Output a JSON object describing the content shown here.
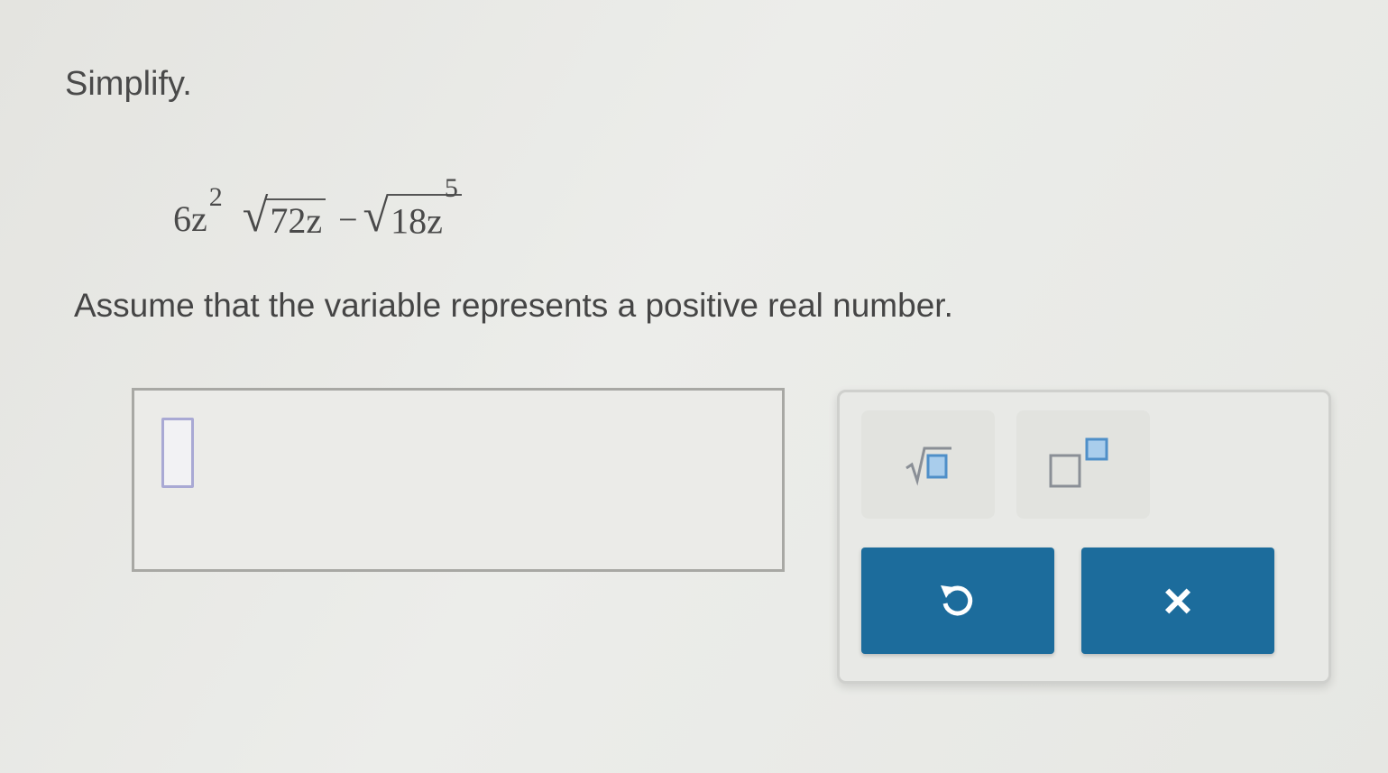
{
  "prompt": "Simplify.",
  "expression": {
    "coefficient": "6z",
    "coefficient_exponent": "2",
    "radicand1": "72z",
    "operator": "−",
    "radicand2": "18z",
    "radicand2_exponent": "5"
  },
  "instructions": "Assume that the variable represents a positive real number.",
  "keypad": {
    "tools": [
      {
        "name": "square-root",
        "icon": "sqrt-template-icon"
      },
      {
        "name": "exponent",
        "icon": "exponent-template-icon"
      }
    ],
    "actions": [
      {
        "name": "undo",
        "icon": "undo-icon"
      },
      {
        "name": "clear",
        "icon": "close-icon",
        "label": "×"
      }
    ],
    "accent_color": "#1c6c9c",
    "template_slot_color": "#6fa6d6"
  }
}
